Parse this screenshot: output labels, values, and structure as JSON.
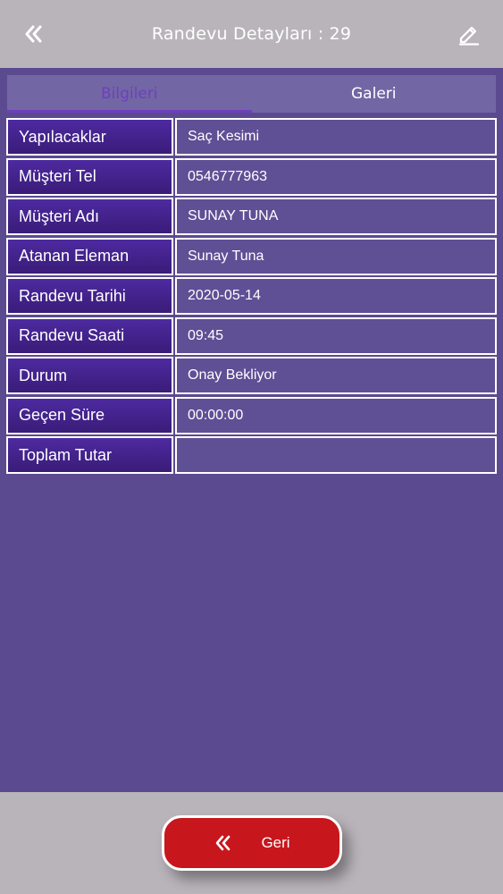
{
  "header": {
    "title": "Randevu Detayları : 29",
    "back_icon": "double-chevron-left-icon",
    "edit_icon": "pencil-icon"
  },
  "tabs": [
    {
      "label": "Bilgileri",
      "active": true
    },
    {
      "label": "Galeri",
      "active": false
    }
  ],
  "details": [
    {
      "label": "Yapılacaklar",
      "value": "Saç Kesimi"
    },
    {
      "label": "Müşteri Tel",
      "value": "0546777963"
    },
    {
      "label": "Müşteri Adı",
      "value": "SUNAY TUNA"
    },
    {
      "label": "Atanan Eleman",
      "value": "Sunay Tuna"
    },
    {
      "label": "Randevu Tarihi",
      "value": "2020-05-14"
    },
    {
      "label": "Randevu Saati",
      "value": "09:45"
    },
    {
      "label": "Durum",
      "value": "Onay Bekliyor"
    },
    {
      "label": "Geçen Süre",
      "value": "00:00:00"
    },
    {
      "label": "Toplam Tutar",
      "value": ""
    }
  ],
  "footer": {
    "back_button_label": "Geri",
    "back_button_icon": "double-chevron-left-icon"
  },
  "colors": {
    "background": "#5b4a90",
    "header_bar": "#b9b4ba",
    "label_cell": "#4d2aa0",
    "active_tab": "#6f3fbf",
    "back_button": "#c8161d"
  }
}
